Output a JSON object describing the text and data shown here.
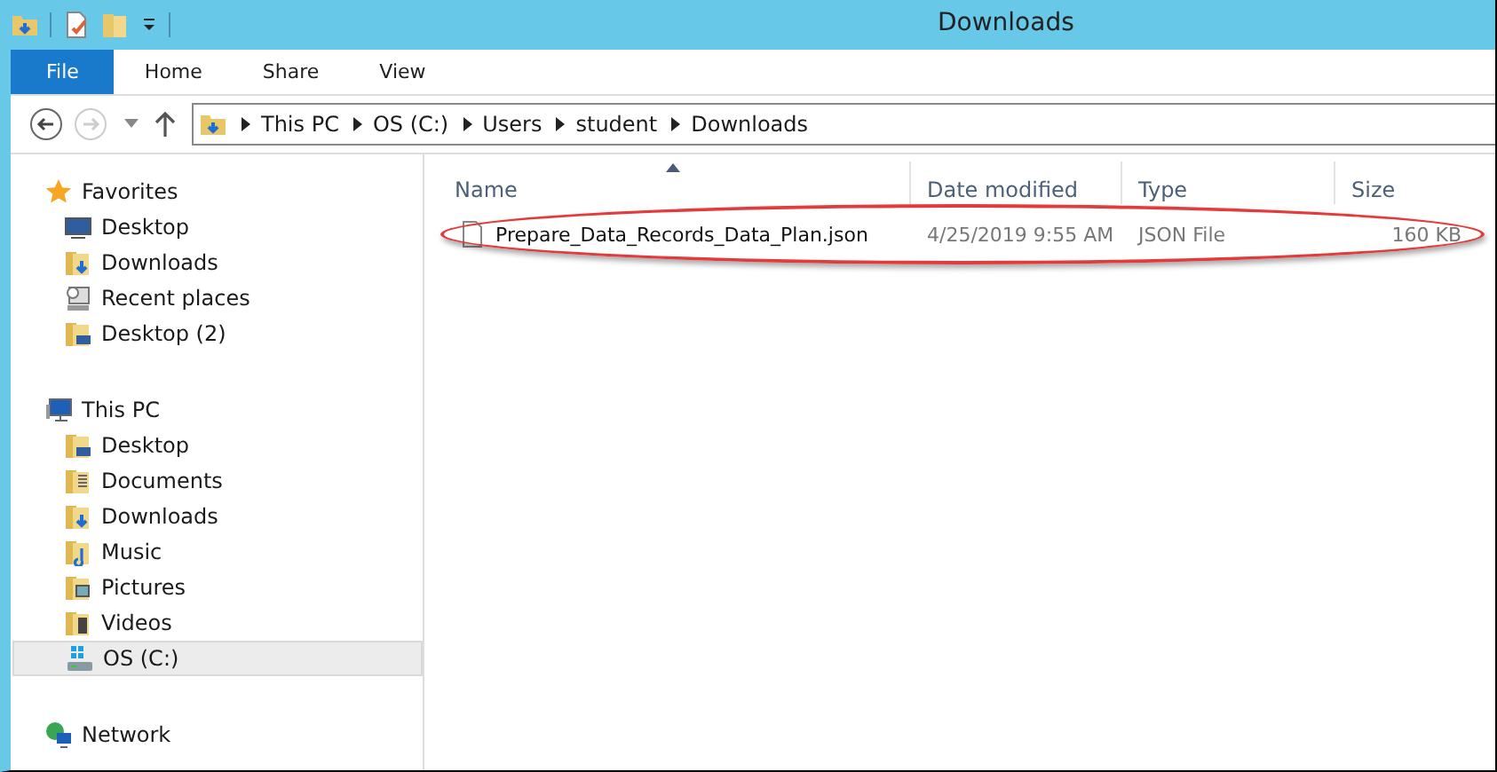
{
  "window": {
    "title": "Downloads"
  },
  "ribbon_tabs": [
    {
      "label": "File",
      "selected": true
    },
    {
      "label": "Home",
      "selected": false
    },
    {
      "label": "Share",
      "selected": false
    },
    {
      "label": "View",
      "selected": false
    }
  ],
  "address": {
    "crumbs": [
      "This PC",
      "OS (C:)",
      "Users",
      "student",
      "Downloads"
    ]
  },
  "sidebar": {
    "groups": [
      {
        "label": "Favorites",
        "kind": "star",
        "items": [
          {
            "label": "Desktop",
            "kind": "desktop",
            "selected": false
          },
          {
            "label": "Downloads",
            "kind": "downloads",
            "selected": false
          },
          {
            "label": "Recent places",
            "kind": "recent",
            "selected": false
          },
          {
            "label": "Desktop (2)",
            "kind": "desktop-folder",
            "selected": false
          }
        ]
      },
      {
        "label": "This PC",
        "kind": "pc",
        "items": [
          {
            "label": "Desktop",
            "kind": "desktop-folder",
            "selected": false
          },
          {
            "label": "Documents",
            "kind": "documents",
            "selected": false
          },
          {
            "label": "Downloads",
            "kind": "downloads",
            "selected": false
          },
          {
            "label": "Music",
            "kind": "music",
            "selected": false
          },
          {
            "label": "Pictures",
            "kind": "pictures",
            "selected": false
          },
          {
            "label": "Videos",
            "kind": "videos",
            "selected": false
          },
          {
            "label": "OS (C:)",
            "kind": "drive",
            "selected": true
          }
        ]
      },
      {
        "label": "Network",
        "kind": "network"
      }
    ]
  },
  "table": {
    "columns": [
      "Name",
      "Date modified",
      "Type",
      "Size"
    ],
    "rows": [
      {
        "cells": [
          "Prepare_Data_Records_Data_Plan.json",
          "4/25/2019 9:55 AM",
          "JSON File",
          "160 KB"
        ],
        "highlighted": true
      }
    ]
  }
}
